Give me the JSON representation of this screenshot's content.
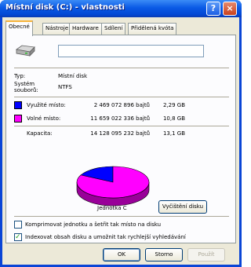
{
  "window": {
    "title": "Místní disk (C:) - vlastnosti"
  },
  "titlebar": {
    "help_glyph": "?",
    "close_glyph": "×"
  },
  "tabs": [
    {
      "label": "Obecné",
      "active": true
    },
    {
      "label": "Nástroje",
      "active": false
    },
    {
      "label": "Hardware",
      "active": false
    },
    {
      "label": "Sdílení",
      "active": false
    },
    {
      "label": "Přidělená kvóta",
      "active": false
    }
  ],
  "general": {
    "name_value": "",
    "type_label": "Typ:",
    "type_value": "Místní disk",
    "fs_label_line1": "Systém",
    "fs_label_line2": "souborů:",
    "fs_value": "NTFS",
    "used": {
      "label": "Využité místo:",
      "bytes": "2 469 072 896 bajtů",
      "size": "2,29 GB",
      "color": "#0000ff"
    },
    "free": {
      "label": "Volné místo:",
      "bytes": "11 659 022 336 bajtů",
      "size": "10,8 GB",
      "color": "#ff00ff"
    },
    "capacity": {
      "label": "Kapacita:",
      "bytes": "14 128 095 232 bajtů",
      "size": "13,1 GB"
    },
    "drive_label": "Jednotka C",
    "cleanup_button": "Vyčištění disku",
    "compress_checkbox": {
      "label": "Komprimovat jednotku a šetřit tak místo na disku",
      "checked": false
    },
    "index_checkbox": {
      "label": "Indexovat obsah disku a umožnit tak rychlejší vyhledávání",
      "checked": true
    }
  },
  "chart_data": {
    "type": "pie",
    "categories": [
      "Využité místo",
      "Volné místo"
    ],
    "values": [
      2469072896,
      11659022336
    ],
    "colors": [
      "#0000ff",
      "#ff00ff"
    ]
  },
  "buttons": {
    "ok": "OK",
    "cancel": "Storno",
    "apply": "Použít"
  }
}
